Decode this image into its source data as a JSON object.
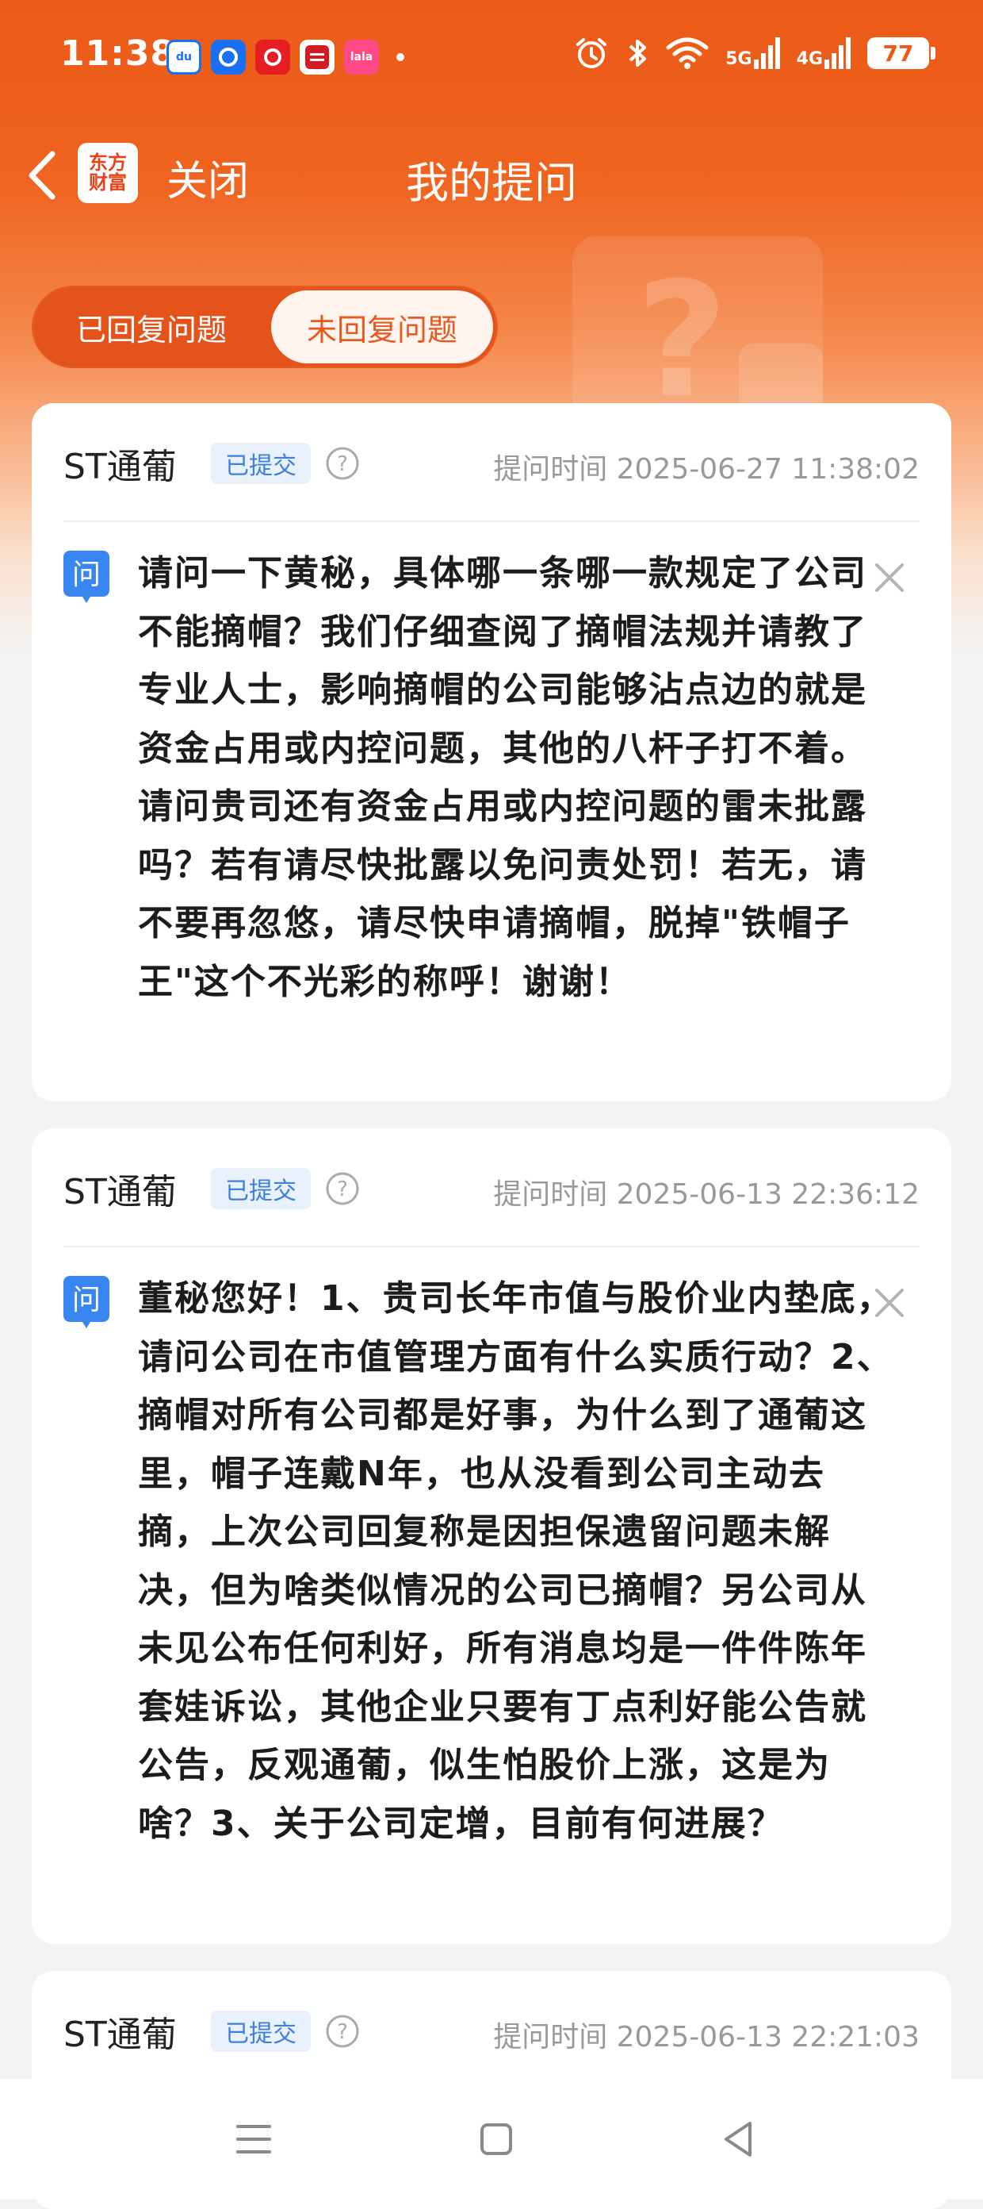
{
  "status_bar": {
    "time": "11:38",
    "apps": [
      "du",
      "云闪付",
      "万达证券",
      "招商证券",
      "lala"
    ],
    "network": [
      "5G",
      "4G"
    ],
    "battery": "77"
  },
  "nav": {
    "logo_line1": "东方",
    "logo_line2": "财富",
    "close_label": "关闭",
    "title": "我的提问"
  },
  "tabs": [
    {
      "label": "已回复问题",
      "active": false
    },
    {
      "label": "未回复问题",
      "active": true
    }
  ],
  "cards": [
    {
      "stock": "ST通葡",
      "status": "已提交",
      "time": "提问时间 2025-06-27 11:38:02",
      "q_label": "问",
      "question": "请问一下黄秘，具体哪一条哪一款规定了公司不能摘帽？我们仔细查阅了摘帽法规并请教了专业人士，影响摘帽的公司能够沾点边的就是资金占用或内控问题，其他的八杆子打不着。请问贵司还有资金占用或内控问题的雷未批露吗？若有请尽快批露以免问责处罚！若无，请不要再忽悠，请尽快申请摘帽，脱掉\"铁帽子王\"这个不光彩的称呼！谢谢！"
    },
    {
      "stock": "ST通葡",
      "status": "已提交",
      "time": "提问时间 2025-06-13 22:36:12",
      "q_label": "问",
      "question": "董秘您好！1、贵司长年市值与股价业内垫底，请问公司在市值管理方面有什么实质行动？2、摘帽对所有公司都是好事，为什么到了通葡这里，帽子连戴N年，也从没看到公司主动去摘，上次公司回复称是因担保遗留问题未解决，但为啥类似情况的公司已摘帽？另公司从未见公布任何利好，所有消息均是一件件陈年套娃诉讼，其他企业只要有丁点利好能公告就公告，反观通葡，似生怕股价上涨，这是为啥？3、关于公司定增，目前有何进展？"
    },
    {
      "stock": "ST通葡",
      "status": "已提交",
      "time": "提问时间 2025-06-13 22:21:03"
    }
  ]
}
